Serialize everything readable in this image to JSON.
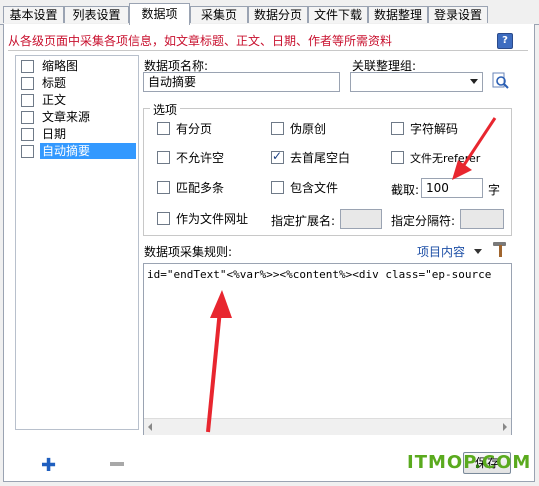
{
  "tabs": [
    {
      "label": "基本设置"
    },
    {
      "label": "列表设置"
    },
    {
      "label": "数据项"
    },
    {
      "label": "采集页"
    },
    {
      "label": "数据分页"
    },
    {
      "label": "文件下载"
    },
    {
      "label": "数据整理"
    },
    {
      "label": "登录设置"
    }
  ],
  "active_tab": "数据项",
  "header": {
    "description": "从各级页面中采集各项信息，如文章标题、正文、日期、作者等所需资料",
    "help_label": "?"
  },
  "items": [
    {
      "label": "缩略图"
    },
    {
      "label": "标题"
    },
    {
      "label": "正文"
    },
    {
      "label": "文章来源"
    },
    {
      "label": "日期"
    },
    {
      "label": "自动摘要"
    }
  ],
  "form": {
    "name_label": "数据项名称:",
    "name_value": "自动摘要",
    "group_label": "关联整理组:",
    "group_value": ""
  },
  "options": {
    "title": "选项",
    "paging": "有分页",
    "pseudo_original": "伪原创",
    "char_decode": "字符解码",
    "disallow_empty": "不允许空",
    "trim_whitespace": "去首尾空白",
    "no_referer": "文件无referer",
    "match_multiple": "匹配多条",
    "include_file": "包含文件",
    "truncate_label": "截取:",
    "truncate_value": "100",
    "truncate_unit": "字",
    "as_file_url": "作为文件网址",
    "ext_label": "指定扩展名:",
    "ext_value": "",
    "sep_label": "指定分隔符:",
    "sep_value": ""
  },
  "rules": {
    "label": "数据项采集规则:",
    "item_content_label": "项目内容",
    "text": "id=\"endText\"<%var%>><%content%><div class=\"ep-source"
  },
  "footer": {
    "add_label": "✚",
    "save_label": "保存",
    "watermark_main": "ITMOP",
    "watermark_dot": ".",
    "watermark_tld": "COM"
  },
  "colors": {
    "accent": "#3399ff",
    "header_text": "#c8102e",
    "link": "#1d4fa6",
    "arrow": "#e8262f"
  }
}
